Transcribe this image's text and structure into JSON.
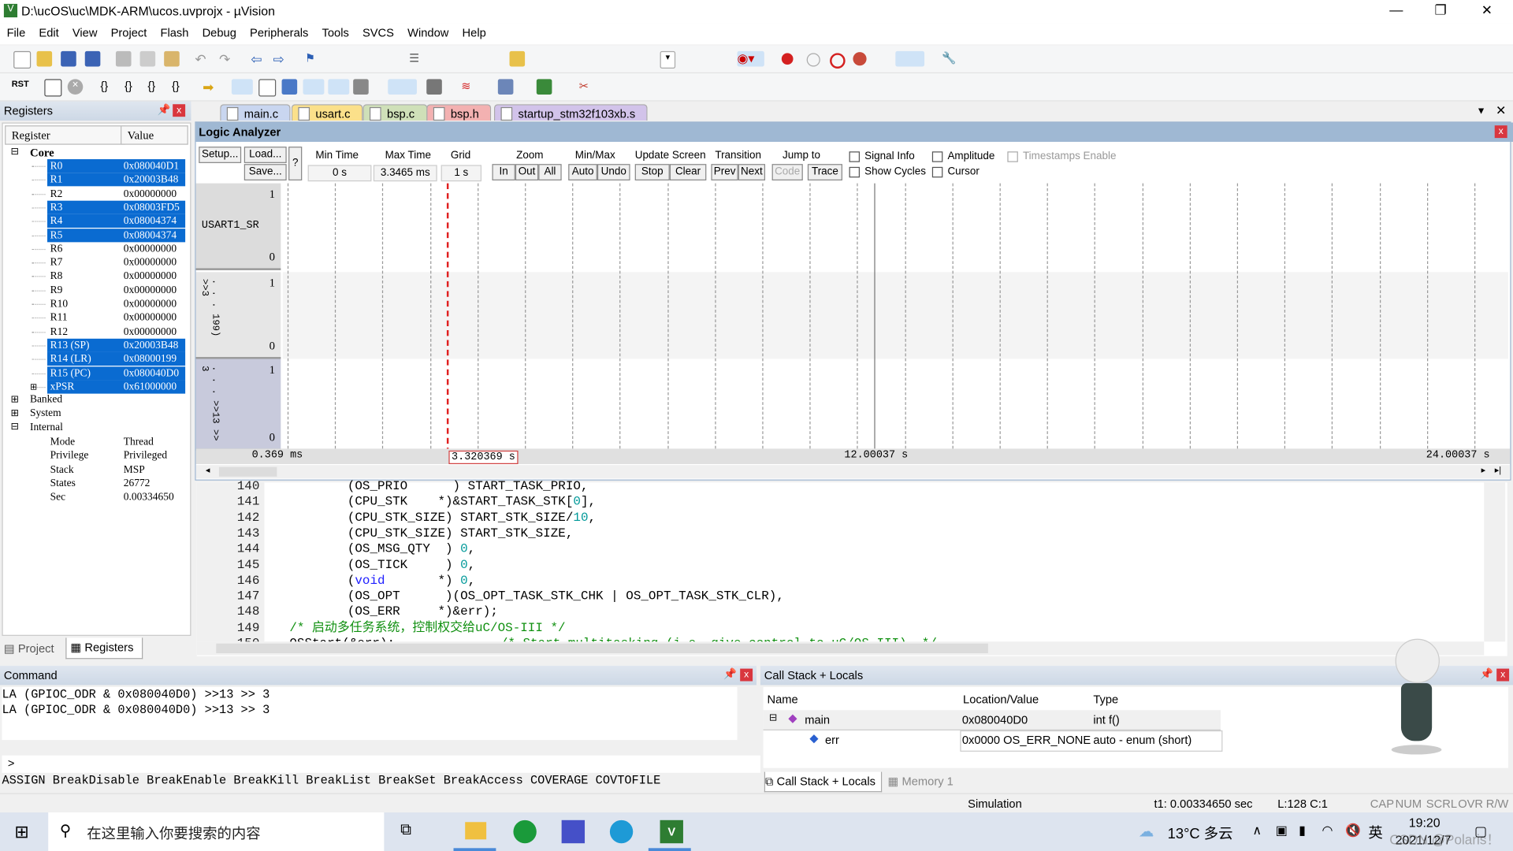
{
  "window": {
    "title": "D:\\ucOS\\uc\\MDK-ARM\\ucos.uvprojx - µVision",
    "minimize": "—",
    "restore": "❐",
    "close": "✕"
  },
  "menu": [
    "File",
    "Edit",
    "View",
    "Project",
    "Flash",
    "Debug",
    "Peripherals",
    "Tools",
    "SVCS",
    "Window",
    "Help"
  ],
  "toolbar": {
    "reset_label": "RST"
  },
  "registers": {
    "title": "Registers",
    "col_register": "Register",
    "col_value": "Value",
    "groups": {
      "core": "Core",
      "banked": "Banked",
      "system": "System",
      "internal": "Internal"
    },
    "core": [
      {
        "name": "R0",
        "value": "0x080040D1",
        "selected": true
      },
      {
        "name": "R1",
        "value": "0x20003B48",
        "selected": true
      },
      {
        "name": "R2",
        "value": "0x00000000",
        "selected": false
      },
      {
        "name": "R3",
        "value": "0x08003FD5",
        "selected": true
      },
      {
        "name": "R4",
        "value": "0x08004374",
        "selected": true
      },
      {
        "name": "R5",
        "value": "0x08004374",
        "selected": true
      },
      {
        "name": "R6",
        "value": "0x00000000",
        "selected": false
      },
      {
        "name": "R7",
        "value": "0x00000000",
        "selected": false
      },
      {
        "name": "R8",
        "value": "0x00000000",
        "selected": false
      },
      {
        "name": "R9",
        "value": "0x00000000",
        "selected": false
      },
      {
        "name": "R10",
        "value": "0x00000000",
        "selected": false
      },
      {
        "name": "R11",
        "value": "0x00000000",
        "selected": false
      },
      {
        "name": "R12",
        "value": "0x00000000",
        "selected": false
      },
      {
        "name": "R13 (SP)",
        "value": "0x20003B48",
        "selected": true
      },
      {
        "name": "R14 (LR)",
        "value": "0x08000199",
        "selected": true
      },
      {
        "name": "R15 (PC)",
        "value": "0x080040D0",
        "selected": true
      },
      {
        "name": "xPSR",
        "value": "0x61000000",
        "selected": true
      }
    ],
    "internal": [
      {
        "name": "Mode",
        "value": "Thread"
      },
      {
        "name": "Privilege",
        "value": "Privileged"
      },
      {
        "name": "Stack",
        "value": "MSP"
      },
      {
        "name": "States",
        "value": "26772"
      },
      {
        "name": "Sec",
        "value": "0.00334650"
      }
    ],
    "tabs": {
      "project": "Project",
      "registers": "Registers"
    }
  },
  "editor_tabs": [
    {
      "label": "main.c",
      "color": "#c9d6f0"
    },
    {
      "label": "usart.c",
      "color": "#fbe08a"
    },
    {
      "label": "bsp.c",
      "color": "#cfe0b8"
    },
    {
      "label": "bsp.h",
      "color": "#f3b1b1"
    },
    {
      "label": "startup_stm32f103xb.s",
      "color": "#d2c3ea"
    }
  ],
  "logic_analyzer": {
    "title": "Logic Analyzer",
    "buttons": {
      "setup": "Setup...",
      "load": "Load...",
      "save": "Save...",
      "help": "?",
      "in": "In",
      "out": "Out",
      "all": "All",
      "auto": "Auto",
      "undo": "Undo",
      "stop": "Stop",
      "clear": "Clear",
      "prev": "Prev",
      "next": "Next",
      "code": "Code",
      "trace": "Trace"
    },
    "labels": {
      "min_time": "Min Time",
      "max_time": "Max Time",
      "grid": "Grid",
      "zoom": "Zoom",
      "minmax": "Min/Max",
      "update_screen": "Update Screen",
      "transition": "Transition",
      "jump_to": "Jump to"
    },
    "values": {
      "min_time": "0 s",
      "max_time": "3.3465 ms",
      "grid": "1 s"
    },
    "options": {
      "signal_info": "Signal Info",
      "show_cycles": "Show Cycles",
      "amplitude": "Amplitude",
      "cursor": "Cursor",
      "timestamps": "Timestamps Enable"
    },
    "signals": [
      {
        "name": "USART1_SR",
        "hi": "1",
        "lo": "0"
      },
      {
        "name": ". . . 199) >>3",
        "hi": "1",
        "lo": "0"
      },
      {
        "name": ". . . >>13 >> 3",
        "hi": "1",
        "lo": "0"
      }
    ],
    "time_axis": {
      "start": "0.369 ms",
      "cursor": "3.320369 s",
      "mid": "12.00037 s",
      "end": "24.00037 s"
    }
  },
  "code": [
    {
      "ln": "140",
      "parts": [
        [
          "",
          "(OS_PRIO      ) START_TASK_PRIO,"
        ]
      ]
    },
    {
      "ln": "141",
      "parts": [
        [
          "",
          "(CPU_STK    *)&START_TASK_STK["
        ],
        [
          "num",
          "0"
        ],
        [
          "",
          "],"
        ]
      ]
    },
    {
      "ln": "142",
      "parts": [
        [
          "",
          "(CPU_STK_SIZE) START_STK_SIZE/"
        ],
        [
          "num",
          "10"
        ],
        [
          "",
          ","
        ]
      ]
    },
    {
      "ln": "143",
      "parts": [
        [
          "",
          "(CPU_STK_SIZE) START_STK_SIZE,"
        ]
      ]
    },
    {
      "ln": "144",
      "parts": [
        [
          "",
          "(OS_MSG_QTY  ) "
        ],
        [
          "num",
          "0"
        ],
        [
          "",
          ","
        ]
      ]
    },
    {
      "ln": "145",
      "parts": [
        [
          "",
          "(OS_TICK     ) "
        ],
        [
          "num",
          "0"
        ],
        [
          "",
          ","
        ]
      ]
    },
    {
      "ln": "146",
      "parts": [
        [
          "",
          "("
        ],
        [
          "kw",
          "void"
        ],
        [
          "",
          "       *) "
        ],
        [
          "num",
          "0"
        ],
        [
          "",
          ","
        ]
      ]
    },
    {
      "ln": "147",
      "parts": [
        [
          "",
          "(OS_OPT      )(OS_OPT_TASK_STK_CHK | OS_OPT_TASK_STK_CLR),"
        ]
      ]
    },
    {
      "ln": "148",
      "parts": [
        [
          "",
          "(OS_ERR     *)&err);"
        ]
      ]
    },
    {
      "ln": "149",
      "parts": [
        [
          "cm",
          "/* 启动多任务系统，控制权交给uC/OS-III */"
        ]
      ],
      "outdent": true
    },
    {
      "ln": "150",
      "parts": [
        [
          "",
          "OSStart(&err);"
        ],
        [
          "cm",
          "              /* Start multitasking (i.e. give control to uC/OS-III). */"
        ]
      ],
      "outdent": true
    }
  ],
  "command": {
    "title": "Command",
    "lines": [
      "LA (GPIOC_ODR & 0x080040D0) >>13 >> 3",
      "LA (GPIOC_ODR & 0x080040D0) >>13 >> 3"
    ],
    "prompt": ">",
    "hints": "ASSIGN BreakDisable BreakEnable BreakKill BreakList BreakSet BreakAccess COVERAGE COVTOFILE"
  },
  "callstack": {
    "title": "Call Stack + Locals",
    "cols": [
      "Name",
      "Location/Value",
      "Type"
    ],
    "rows": [
      {
        "name": "main",
        "value": "0x080040D0",
        "type": "int f()"
      },
      {
        "name": "err",
        "value": "0x0000 OS_ERR_NONE",
        "type": "auto - enum (short)"
      }
    ],
    "tabs": {
      "callstack": "Call Stack + Locals",
      "memory": "Memory 1"
    }
  },
  "status": {
    "mode": "Simulation",
    "t1": "t1: 0.00334650 sec",
    "pos": "L:128 C:1",
    "cap": "CAP",
    "num": "NUM",
    "scrl": "SCRL",
    "ovr": "OVR",
    "rw": "R/W"
  },
  "taskbar": {
    "search_placeholder": "在这里输入你要搜索的内容",
    "weather": "13°C 多云",
    "ime": "英",
    "time": "19:20",
    "date": "2021/12/7",
    "watermark": "CSDN @Polaris！"
  },
  "colors": {
    "selection": "#0a6bd1",
    "cursor_line": "#e02020",
    "panel_header": "#cdd8e6"
  }
}
